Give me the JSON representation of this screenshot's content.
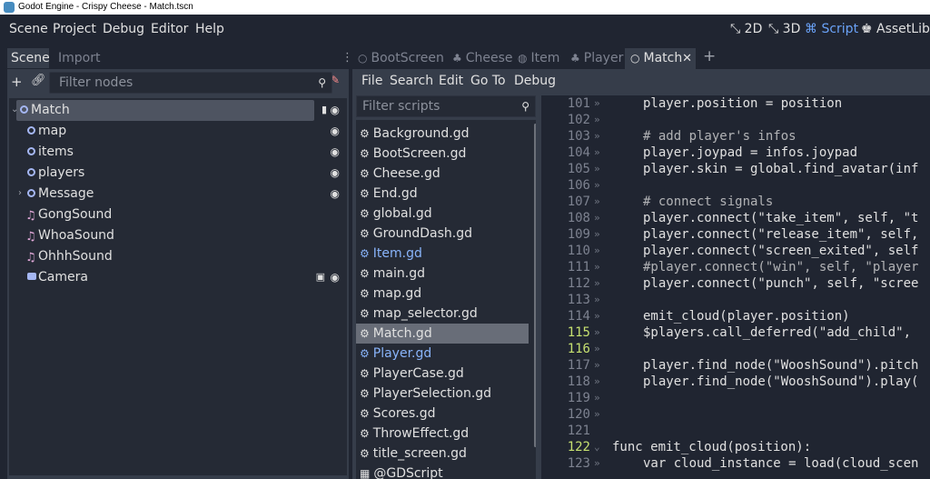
{
  "window": {
    "title": "Godot Engine - Crispy Cheese - Match.tscn"
  },
  "menubar": {
    "items": [
      "Scene",
      "Project",
      "Debug",
      "Editor",
      "Help"
    ],
    "workspaces": [
      {
        "label": "2D",
        "icon": "2d-icon"
      },
      {
        "label": "3D",
        "icon": "3d-icon"
      },
      {
        "label": "Script",
        "icon": "script-icon",
        "active": true
      },
      {
        "label": "AssetLib",
        "icon": "assetlib-icon"
      }
    ]
  },
  "scene_dock": {
    "tabs": [
      "Scene",
      "Import"
    ],
    "filter_placeholder": "Filter nodes",
    "nodes": [
      {
        "label": "Match",
        "icon": "node2d-icon",
        "expanded": true,
        "selected": true
      },
      {
        "label": "map",
        "icon": "node2d-icon"
      },
      {
        "label": "items",
        "icon": "node2d-icon"
      },
      {
        "label": "players",
        "icon": "node2d-icon"
      },
      {
        "label": "Message",
        "icon": "node2d-icon",
        "collapsed": true
      },
      {
        "label": "GongSound",
        "icon": "audio-icon"
      },
      {
        "label": "WhoaSound",
        "icon": "audio-icon"
      },
      {
        "label": "OhhhSound",
        "icon": "audio-icon"
      },
      {
        "label": "Camera",
        "icon": "camera-icon"
      }
    ]
  },
  "editor": {
    "tabs": [
      {
        "label": "BootScreen",
        "icon": "node-icon"
      },
      {
        "label": "Cheese",
        "icon": "sprite-icon"
      },
      {
        "label": "Item",
        "icon": "globe-icon"
      },
      {
        "label": "Player",
        "icon": "sprite-icon"
      },
      {
        "label": "Match",
        "icon": "node-icon",
        "active": true
      }
    ],
    "script_menu": [
      "File",
      "Search",
      "Edit",
      "Go To",
      "Debug"
    ],
    "filter_scripts_placeholder": "Filter scripts",
    "scripts": [
      "Background.gd",
      "BootScreen.gd",
      "Cheese.gd",
      "End.gd",
      "global.gd",
      "GroundDash.gd",
      "Item.gd",
      "main.gd",
      "map.gd",
      "map_selector.gd",
      "Match.gd",
      "Player.gd",
      "PlayerCase.gd",
      "PlayerSelection.gd",
      "Scores.gd",
      "ThrowEffect.gd",
      "title_screen.gd",
      "@GDScript"
    ],
    "selected_script": "Match.gd",
    "tool_scripts": [
      "Item.gd",
      "Player.gd"
    ]
  },
  "code": {
    "current_line": 115,
    "lines": [
      {
        "n": "101",
        "t": "player.position = position"
      },
      {
        "n": "102",
        "t": ""
      },
      {
        "n": "103",
        "t": "# add player's infos"
      },
      {
        "n": "104",
        "t": "player.joypad = infos.joypad"
      },
      {
        "n": "105",
        "t": "player.skin = global.find_avatar(inf"
      },
      {
        "n": "106",
        "t": ""
      },
      {
        "n": "107",
        "t": "# connect signals"
      },
      {
        "n": "108",
        "t": "player.connect(\"take_item\", self, \"t"
      },
      {
        "n": "109",
        "t": "player.connect(\"release_item\", self,"
      },
      {
        "n": "110",
        "t": "player.connect(\"screen_exited\", self"
      },
      {
        "n": "111",
        "t": "#player.connect(\"win\", self, \"player"
      },
      {
        "n": "112",
        "t": "player.connect(\"punch\", self, \"scree"
      },
      {
        "n": "113",
        "t": ""
      },
      {
        "n": "114",
        "t": "emit_cloud(player.position)"
      },
      {
        "n": "115",
        "t": "$players.call_deferred(\"add_child\","
      },
      {
        "n": "116",
        "t": ""
      },
      {
        "n": "117",
        "t": "player.find_node(\"WooshSound\").pitch"
      },
      {
        "n": "118",
        "t": "player.find_node(\"WooshSound\").play("
      },
      {
        "n": "119",
        "t": ""
      },
      {
        "n": "120",
        "t": ""
      },
      {
        "n": "121",
        "t": ""
      },
      {
        "n": "122",
        "t": "func emit_cloud(position):"
      },
      {
        "n": "123",
        "t": "var cloud_instance = load(cloud_scen"
      }
    ]
  },
  "colors": {
    "accent": "#6aa2f7",
    "panel_bg": "#363d4a",
    "dark_bg": "#202531",
    "keyword": "#ff7085",
    "string": "#ffeda1",
    "function": "#66e6ff"
  }
}
